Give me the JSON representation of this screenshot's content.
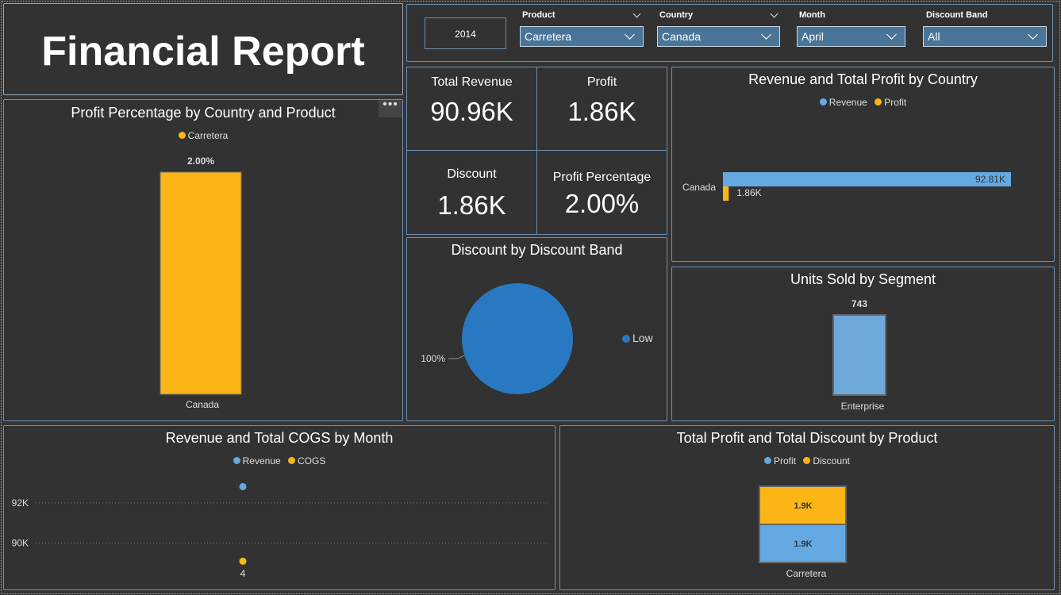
{
  "header": {
    "title": "Financial Report"
  },
  "filters": {
    "year": "2014",
    "product": {
      "label": "Product",
      "value": "Carretera"
    },
    "country": {
      "label": "Country",
      "value": "Canada"
    },
    "month": {
      "label": "Month",
      "value": "April"
    },
    "discount_band": {
      "label": "Discount Band",
      "value": "All"
    }
  },
  "kpis": {
    "total_revenue": {
      "label": "Total Revenue",
      "value": "90.96K"
    },
    "profit": {
      "label": "Profit",
      "value": "1.86K"
    },
    "discount": {
      "label": "Discount",
      "value": "1.86K"
    },
    "profit_percentage": {
      "label": "Profit Percentage",
      "value": "2.00%"
    }
  },
  "menu_icon": "more-options-icon",
  "colors": {
    "revenue": "#64a9e2",
    "profit": "#fbb616",
    "pie": "#2979c2",
    "units": "#6fa9db"
  },
  "chart_data": [
    {
      "id": "profit_pct",
      "type": "bar",
      "title": "Profit Percentage by Country and Product",
      "categories": [
        "Canada"
      ],
      "series": [
        {
          "name": "Carretera",
          "values": [
            2.0
          ]
        }
      ],
      "data_labels": [
        "2.00%"
      ],
      "ylim": [
        0,
        2.0
      ]
    },
    {
      "id": "rev_profit_country",
      "type": "bar",
      "orientation": "horizontal",
      "title": "Revenue and Total Profit by Country",
      "categories": [
        "Canada"
      ],
      "series": [
        {
          "name": "Revenue",
          "values": [
            92810
          ],
          "label": "92.81K"
        },
        {
          "name": "Profit",
          "values": [
            1860
          ],
          "label": "1.86K"
        }
      ],
      "xlim": [
        0,
        92810
      ]
    },
    {
      "id": "discount_band",
      "type": "pie",
      "title": "Discount by Discount Band",
      "slices": [
        {
          "name": "Low",
          "value": 100,
          "label": "100%"
        }
      ]
    },
    {
      "id": "units_segment",
      "type": "bar",
      "title": "Units Sold by Segment",
      "categories": [
        "Enterprise"
      ],
      "values": [
        743
      ],
      "data_labels": [
        "743"
      ],
      "ylim": [
        0,
        743
      ]
    },
    {
      "id": "rev_cogs_month",
      "type": "scatter",
      "title": "Revenue and Total COGS by Month",
      "categories": [
        "4"
      ],
      "yticks": [
        "92K",
        "90K"
      ],
      "ytick_values": [
        92000,
        90000
      ],
      "series": [
        {
          "name": "Revenue",
          "values": [
            92810
          ]
        },
        {
          "name": "COGS",
          "values": [
            89100
          ]
        }
      ],
      "ylim": [
        88800,
        93300
      ]
    },
    {
      "id": "profit_discount_product",
      "type": "bar",
      "stacked": true,
      "title": "Total Profit and Total Discount by Product",
      "categories": [
        "Carretera"
      ],
      "series": [
        {
          "name": "Profit",
          "values": [
            1860
          ],
          "label": "1.9K"
        },
        {
          "name": "Discount",
          "values": [
            1860
          ],
          "label": "1.9K"
        }
      ]
    }
  ]
}
